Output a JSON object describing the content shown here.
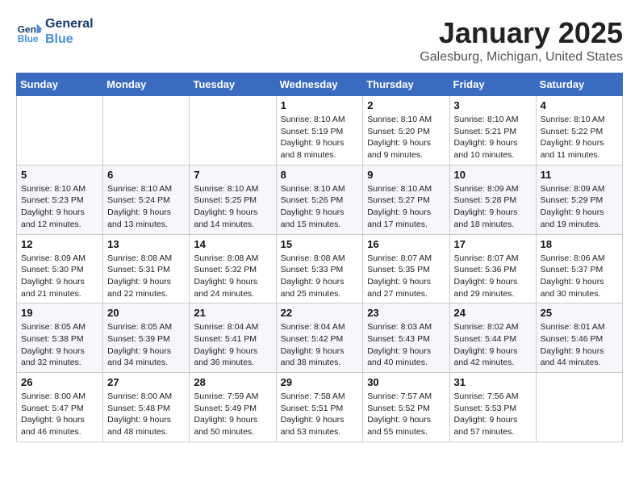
{
  "header": {
    "logo_line1": "General",
    "logo_line2": "Blue",
    "month": "January 2025",
    "location": "Galesburg, Michigan, United States"
  },
  "weekdays": [
    "Sunday",
    "Monday",
    "Tuesday",
    "Wednesday",
    "Thursday",
    "Friday",
    "Saturday"
  ],
  "weeks": [
    [
      {
        "day": "",
        "info": ""
      },
      {
        "day": "",
        "info": ""
      },
      {
        "day": "",
        "info": ""
      },
      {
        "day": "1",
        "info": "Sunrise: 8:10 AM\nSunset: 5:19 PM\nDaylight: 9 hours and 8 minutes."
      },
      {
        "day": "2",
        "info": "Sunrise: 8:10 AM\nSunset: 5:20 PM\nDaylight: 9 hours and 9 minutes."
      },
      {
        "day": "3",
        "info": "Sunrise: 8:10 AM\nSunset: 5:21 PM\nDaylight: 9 hours and 10 minutes."
      },
      {
        "day": "4",
        "info": "Sunrise: 8:10 AM\nSunset: 5:22 PM\nDaylight: 9 hours and 11 minutes."
      }
    ],
    [
      {
        "day": "5",
        "info": "Sunrise: 8:10 AM\nSunset: 5:23 PM\nDaylight: 9 hours and 12 minutes."
      },
      {
        "day": "6",
        "info": "Sunrise: 8:10 AM\nSunset: 5:24 PM\nDaylight: 9 hours and 13 minutes."
      },
      {
        "day": "7",
        "info": "Sunrise: 8:10 AM\nSunset: 5:25 PM\nDaylight: 9 hours and 14 minutes."
      },
      {
        "day": "8",
        "info": "Sunrise: 8:10 AM\nSunset: 5:26 PM\nDaylight: 9 hours and 15 minutes."
      },
      {
        "day": "9",
        "info": "Sunrise: 8:10 AM\nSunset: 5:27 PM\nDaylight: 9 hours and 17 minutes."
      },
      {
        "day": "10",
        "info": "Sunrise: 8:09 AM\nSunset: 5:28 PM\nDaylight: 9 hours and 18 minutes."
      },
      {
        "day": "11",
        "info": "Sunrise: 8:09 AM\nSunset: 5:29 PM\nDaylight: 9 hours and 19 minutes."
      }
    ],
    [
      {
        "day": "12",
        "info": "Sunrise: 8:09 AM\nSunset: 5:30 PM\nDaylight: 9 hours and 21 minutes."
      },
      {
        "day": "13",
        "info": "Sunrise: 8:08 AM\nSunset: 5:31 PM\nDaylight: 9 hours and 22 minutes."
      },
      {
        "day": "14",
        "info": "Sunrise: 8:08 AM\nSunset: 5:32 PM\nDaylight: 9 hours and 24 minutes."
      },
      {
        "day": "15",
        "info": "Sunrise: 8:08 AM\nSunset: 5:33 PM\nDaylight: 9 hours and 25 minutes."
      },
      {
        "day": "16",
        "info": "Sunrise: 8:07 AM\nSunset: 5:35 PM\nDaylight: 9 hours and 27 minutes."
      },
      {
        "day": "17",
        "info": "Sunrise: 8:07 AM\nSunset: 5:36 PM\nDaylight: 9 hours and 29 minutes."
      },
      {
        "day": "18",
        "info": "Sunrise: 8:06 AM\nSunset: 5:37 PM\nDaylight: 9 hours and 30 minutes."
      }
    ],
    [
      {
        "day": "19",
        "info": "Sunrise: 8:05 AM\nSunset: 5:38 PM\nDaylight: 9 hours and 32 minutes."
      },
      {
        "day": "20",
        "info": "Sunrise: 8:05 AM\nSunset: 5:39 PM\nDaylight: 9 hours and 34 minutes."
      },
      {
        "day": "21",
        "info": "Sunrise: 8:04 AM\nSunset: 5:41 PM\nDaylight: 9 hours and 36 minutes."
      },
      {
        "day": "22",
        "info": "Sunrise: 8:04 AM\nSunset: 5:42 PM\nDaylight: 9 hours and 38 minutes."
      },
      {
        "day": "23",
        "info": "Sunrise: 8:03 AM\nSunset: 5:43 PM\nDaylight: 9 hours and 40 minutes."
      },
      {
        "day": "24",
        "info": "Sunrise: 8:02 AM\nSunset: 5:44 PM\nDaylight: 9 hours and 42 minutes."
      },
      {
        "day": "25",
        "info": "Sunrise: 8:01 AM\nSunset: 5:46 PM\nDaylight: 9 hours and 44 minutes."
      }
    ],
    [
      {
        "day": "26",
        "info": "Sunrise: 8:00 AM\nSunset: 5:47 PM\nDaylight: 9 hours and 46 minutes."
      },
      {
        "day": "27",
        "info": "Sunrise: 8:00 AM\nSunset: 5:48 PM\nDaylight: 9 hours and 48 minutes."
      },
      {
        "day": "28",
        "info": "Sunrise: 7:59 AM\nSunset: 5:49 PM\nDaylight: 9 hours and 50 minutes."
      },
      {
        "day": "29",
        "info": "Sunrise: 7:58 AM\nSunset: 5:51 PM\nDaylight: 9 hours and 53 minutes."
      },
      {
        "day": "30",
        "info": "Sunrise: 7:57 AM\nSunset: 5:52 PM\nDaylight: 9 hours and 55 minutes."
      },
      {
        "day": "31",
        "info": "Sunrise: 7:56 AM\nSunset: 5:53 PM\nDaylight: 9 hours and 57 minutes."
      },
      {
        "day": "",
        "info": ""
      }
    ]
  ]
}
